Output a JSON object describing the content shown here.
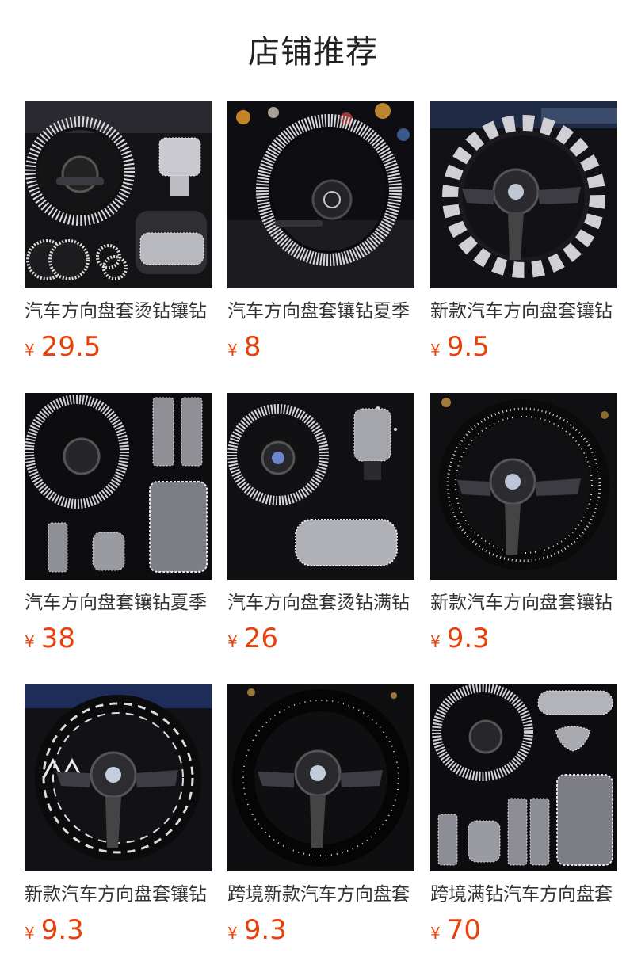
{
  "header": {
    "title": "店铺推荐"
  },
  "theme": {
    "price_color": "#e8420a",
    "title_color": "#222222",
    "text_color": "#333333",
    "background": "#ffffff"
  },
  "currency_symbol": "¥",
  "products": [
    {
      "name": "汽车方向盘套烫钻镶钻",
      "price": "29.5",
      "image": "steering-wheel-cover-set-with-accessories"
    },
    {
      "name": "汽车方向盘套镶钻夏季",
      "price": "8",
      "image": "rhinestone-steering-wheel-cover-bokeh"
    },
    {
      "name": "新款汽车方向盘套镶钻",
      "price": "9.5",
      "image": "zigzag-rhinestone-steering-wheel-cover"
    },
    {
      "name": "汽车方向盘套镶钻夏季",
      "price": "38",
      "image": "steering-wheel-cover-set-with-seatbelt-pads"
    },
    {
      "name": "汽车方向盘套烫钻满钻",
      "price": "26",
      "image": "steering-wheel-cover-with-armrest-pad"
    },
    {
      "name": "新款汽车方向盘套镶钻",
      "price": "9.3",
      "image": "dotted-rhinestone-steering-wheel-cover"
    },
    {
      "name": "新款汽车方向盘套镶钻",
      "price": "9.3",
      "image": "diamond-pattern-steering-wheel-cover"
    },
    {
      "name": "跨境新款汽车方向盘套",
      "price": "9.3",
      "image": "black-plush-rhinestone-steering-wheel-cover"
    },
    {
      "name": "跨境满钻汽车方向盘套",
      "price": "70",
      "image": "full-rhinestone-interior-accessory-set"
    }
  ]
}
